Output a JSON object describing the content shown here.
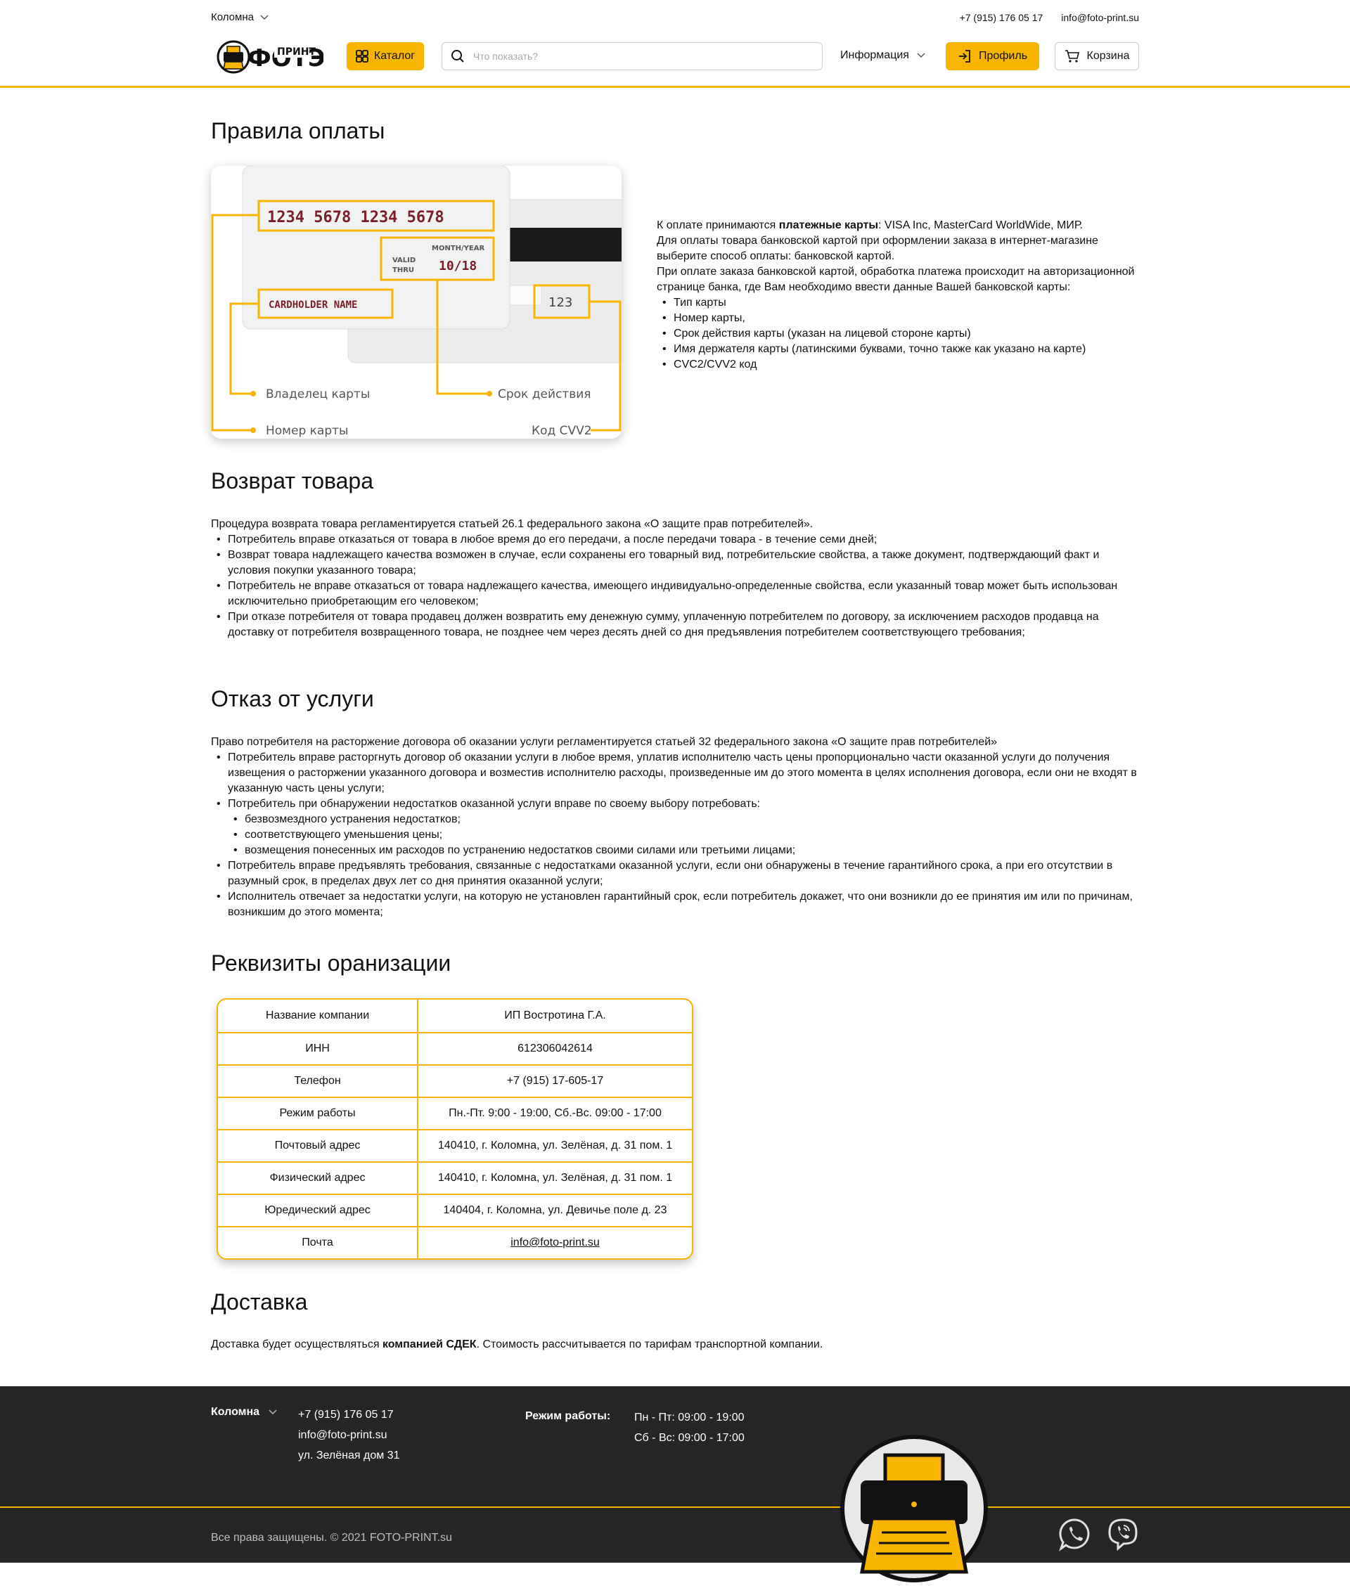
{
  "topbar": {
    "city": "Коломна",
    "phone": "+7 (915) 176 05 17",
    "email": "info@foto-print.su"
  },
  "header": {
    "catalog_label": "Каталог",
    "search_placeholder": "Что показать?",
    "info_label": "Информация",
    "profile_label": "Профиль",
    "cart_label": "Корзина"
  },
  "payment": {
    "title": "Правила оплаты",
    "card": {
      "number": "1234 5678 1234 5678",
      "valid_thru_1": "VALID",
      "valid_thru_2": "THRU",
      "month_year": "MONTH/YEAR",
      "expiry": "10/18",
      "holder": "CARDHOLDER NAME",
      "cvv": "123",
      "label_owner": "Владелец карты",
      "label_expiry": "Срок действия",
      "label_number": "Номер карты",
      "label_cvv": "Код CVV2"
    },
    "intro_pre": "К оплате принимаются ",
    "intro_bold": "платежные карты",
    "intro_post": ": VISA Inc, MasterCard WorldWide, МИР.",
    "line2": "Для оплаты товара банковской картой при оформлении заказа в интернет-магазине выберите способ оплаты: банковской картой.",
    "line3": "При оплате заказа банковской картой, обработка платежа происходит на авторизационной странице банка, где Вам необходимо ввести данные Вашей банковской карты:",
    "items": [
      "Тип карты",
      "Номер карты,",
      "Срок действия карты (указан на лицевой стороне карты)",
      "Имя держателя карты (латинскими буквами, точно также как указано на карте)",
      "CVC2/CVV2 код"
    ]
  },
  "returns": {
    "title": "Возврат товара",
    "intro": "Процедура возврата товара регламентируется статьей 26.1 федерального закона «О защите прав потребителей».",
    "items": [
      " Потребитель вправе отказаться от товара в любое время до его передачи, а после передачи товара - в течение семи дней;",
      " Возврат товара надлежащего качества возможен в случае, если сохранены его товарный вид, потребительские свойства, а также документ, подтверждающий факт и условия покупки указанного товара;",
      " Потребитель не вправе отказаться от товара надлежащего качества, имеющего индивидуально-определенные свойства, если указанный товар может быть использован исключительно приобретающим его человеком;",
      " При отказе потребителя от товара продавец должен возвратить ему денежную сумму, уплаченную потребителем по договору, за исключением расходов продавца на доставку от потребителя возвращенного товара, не позднее чем через десять дней со дня предъявления потребителем соответствующего требования;"
    ]
  },
  "refusal": {
    "title": "Отказ от услуги",
    "intro": "Право потребителя на расторжение договора об оказании услуги регламентируется статьей 32 федерального закона «О защите прав потребителей»",
    "item1": "Потребитель вправе расторгнуть договор об оказании услуги в любое время, уплатив исполнителю часть цены пропорционально части оказанной услуги до получения извещения о расторжении указанного договора и возместив исполнителю расходы, произведенные им до этого момента в целях исполнения договора, если они не входят в указанную часть цены услуги;",
    "item2": "Потребитель при обнаружении недостатков оказанной услуги вправе по своему выбору потребовать:",
    "subitems": [
      "безвозмездного устранения недостатков;",
      "соответствующего уменьшения цены;",
      "возмещения понесенных им расходов по устранению недостатков своими силами или третьими лицами;"
    ],
    "item3": "Потребитель вправе предъявлять требования, связанные с недостатками оказанной услуги, если они обнаружены в течение гарантийного срока, а при его отсутствии в разумный срок, в пределах двух лет со дня принятия оказанной услуги;",
    "item4": "Исполнитель отвечает за недостатки услуги, на которую не установлен гарантийный срок, если потребитель докажет, что они возникли до ее принятия им или по причинам, возникшим до этого момента;"
  },
  "requisites": {
    "title": "Реквизиты оранизации",
    "rows": [
      {
        "label": "Название компании",
        "value": "ИП Востротина Г.А."
      },
      {
        "label": "ИНН",
        "value": "612306042614"
      },
      {
        "label": "Телефон",
        "value": "+7 (915) 17-605-17"
      },
      {
        "label": "Режим работы",
        "value": "Пн.-Пт. 9:00 - 19:00, Сб.-Вс. 09:00 - 17:00"
      },
      {
        "label": "Почтовый адрес",
        "value": "140410, г. Коломна, ул. Зелёная, д. 31 пом. 1"
      },
      {
        "label": "Физический адрес",
        "value": "140410, г. Коломна, ул. Зелёная, д. 31 пом. 1"
      },
      {
        "label": "Юредический адрес",
        "value": "140404, г. Коломна, ул. Девичье поле д. 23"
      },
      {
        "label": "Почта",
        "value": "info@foto-print.su"
      }
    ]
  },
  "delivery": {
    "title": "Доставка",
    "pre": "Доставка будет осуществляться ",
    "bold": "компанией СДЕК",
    "post": ". Стоимость рассчитывается по тарифам транспортной компании."
  },
  "footer": {
    "city": "Коломна",
    "phone": "+7 (915) 176 05 17",
    "email": "info@foto-print.su",
    "address": "ул. Зелёная дом 31",
    "hours_label": "Режим работы:",
    "hours_weekdays": "Пн - Пт: 09:00 - 19:00",
    "hours_weekend": "Сб - Вс: 09:00 - 17:00",
    "copyright": "Все права защищены. © 2021 FOTO-PRINT.su"
  },
  "colors": {
    "accent": "#f7b500",
    "footer_bg": "#262626",
    "text": "#111111"
  },
  "logo_text": "ФОТО ПРИНТ"
}
